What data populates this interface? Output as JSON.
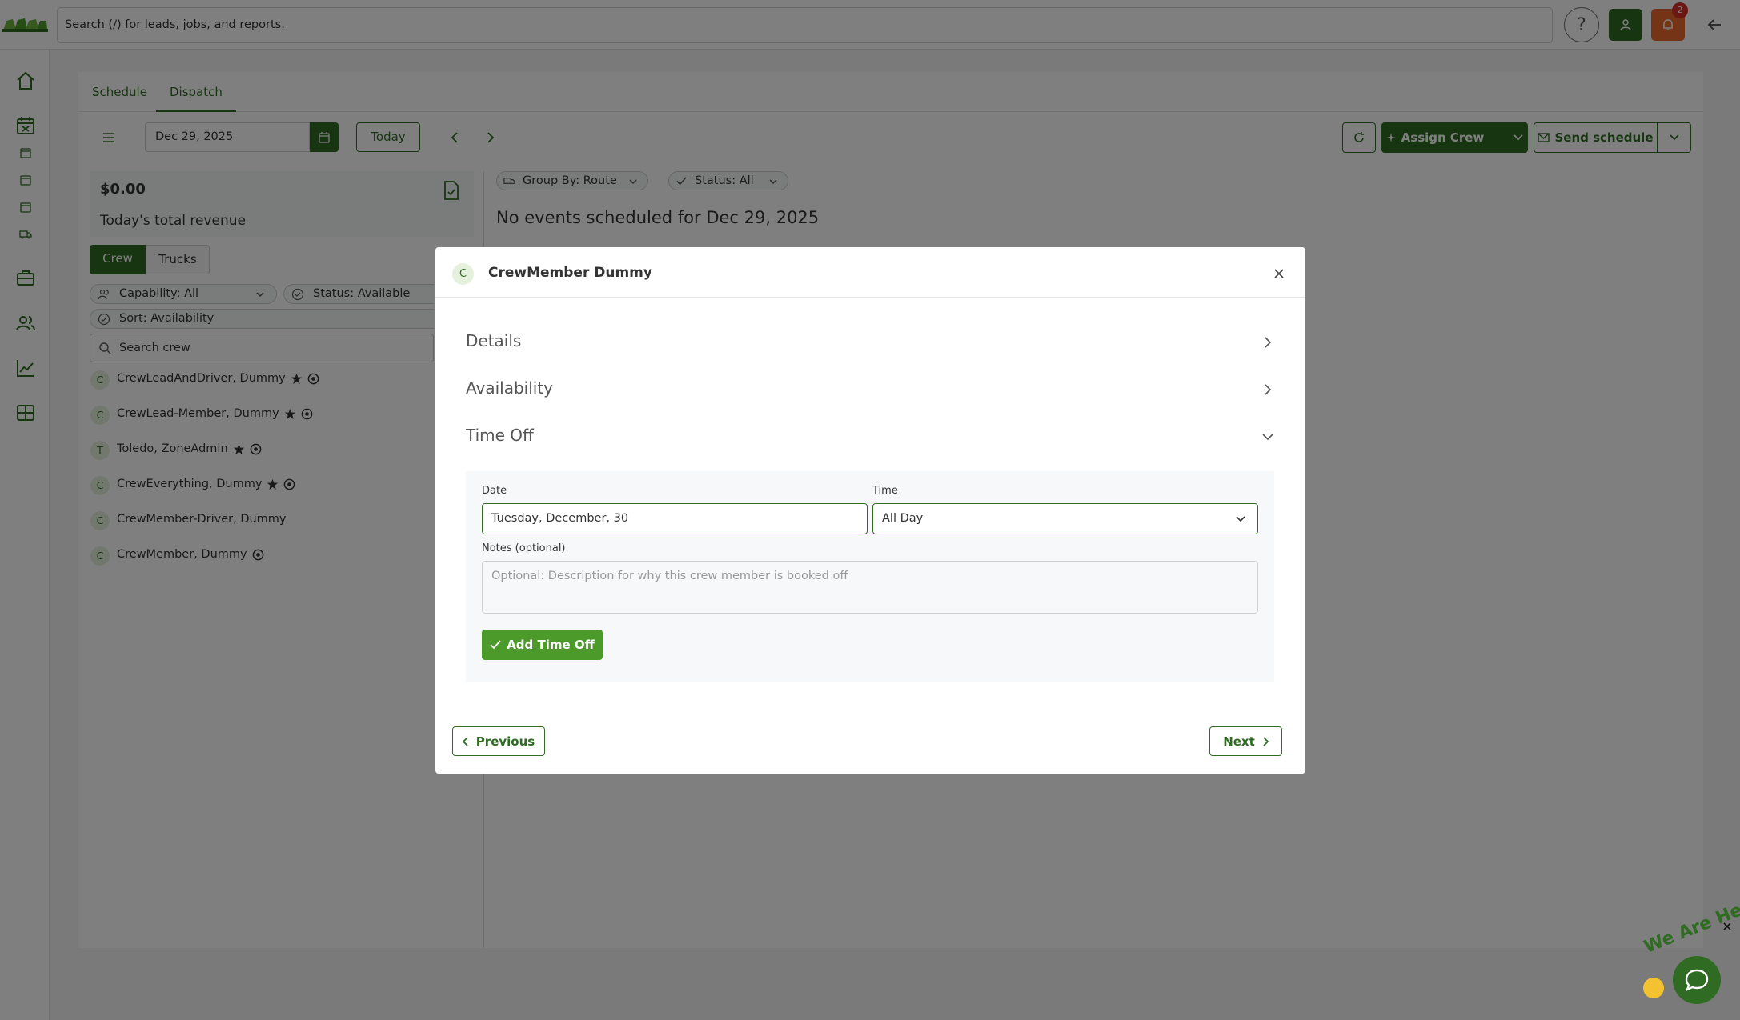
{
  "topbar": {
    "search_placeholder": "Search (/) for leads, jobs, and reports.",
    "help_symbol": "?",
    "notification_count": "2"
  },
  "tabs": [
    {
      "label": "Schedule"
    },
    {
      "label": "Dispatch"
    }
  ],
  "toolbar": {
    "date_value": "Dec 29, 2025",
    "today_label": "Today",
    "assign_label": "Assign Crew",
    "send_label": "Send schedule"
  },
  "revenue": {
    "amount": "$0.00",
    "label": "Today's total revenue"
  },
  "crew_panel": {
    "seg_crew": "Crew",
    "seg_trucks": "Trucks",
    "filter_capability": "Capability: All",
    "filter_status": "Status: Available",
    "sort": "Sort: Availability",
    "search_placeholder": "Search crew",
    "members": [
      {
        "initial": "C",
        "name": "CrewLeadAndDriver, Dummy"
      },
      {
        "initial": "C",
        "name": "CrewLead-Member, Dummy"
      },
      {
        "initial": "T",
        "name": "Toledo, ZoneAdmin"
      },
      {
        "initial": "C",
        "name": "CrewEverything, Dummy"
      },
      {
        "initial": "C",
        "name": "CrewMember-Driver, Dummy"
      },
      {
        "initial": "C",
        "name": "CrewMember, Dummy"
      }
    ]
  },
  "schedule": {
    "group_by": "Group By: Route",
    "status": "Status: All",
    "empty_message": "No events scheduled for Dec 29, 2025"
  },
  "modal": {
    "avatar_initial": "C",
    "title": "CrewMember Dummy",
    "sections": {
      "details": "Details",
      "availability": "Availability",
      "time_off": "Time Off"
    },
    "time_off": {
      "date_label": "Date",
      "date_value": "Tuesday, December, 30",
      "time_label": "Time",
      "time_value": "All Day",
      "notes_label": "Notes (optional)",
      "notes_placeholder": "Optional: Description for why this crew member is booked off",
      "add_label": "Add Time Off"
    },
    "previous_label": "Previous",
    "next_label": "Next"
  },
  "chat": {
    "text": "We Are Here!"
  },
  "colors": {
    "brand_green": "#2f6b22",
    "accent_green": "#4c9a2a",
    "notification_orange": "#e8682b"
  },
  "icons": [
    "logo-icon",
    "help-icon",
    "user-icon",
    "bell-icon",
    "back-arrow-icon",
    "home-icon",
    "calendar-icon",
    "briefcase-icon",
    "users-icon",
    "chart-icon",
    "grid-icon",
    "menu-icon",
    "chevron-left-icon",
    "chevron-right-icon",
    "refresh-icon",
    "sparkle-icon",
    "mail-icon",
    "caret-down-icon",
    "document-icon",
    "star-icon",
    "badge-icon",
    "search-icon",
    "close-icon",
    "check-icon",
    "chat-icon"
  ]
}
